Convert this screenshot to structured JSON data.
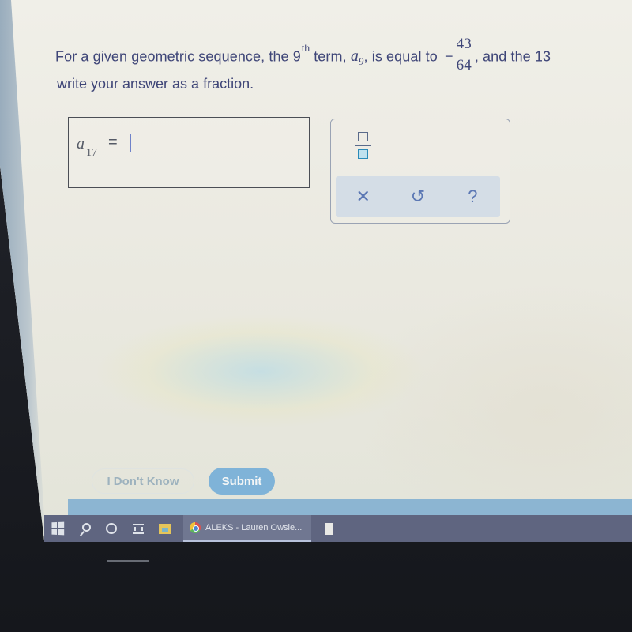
{
  "question": {
    "part1": "For a given geometric sequence, the 9",
    "ordinal_suffix": "th",
    "part2": " term, ",
    "term_symbol": "a",
    "term_index": "9",
    "part3": ", is equal to",
    "value_sign": "−",
    "value_numerator": "43",
    "value_denominator": "64",
    "part4": ", and the 13",
    "line2": "write your answer as a fraction."
  },
  "answer": {
    "label_symbol": "a",
    "label_index": "17",
    "equals": "=",
    "value": ""
  },
  "palette": {
    "fraction_tool_label": "fraction",
    "actions": [
      {
        "name": "clear",
        "glyph": "✕"
      },
      {
        "name": "undo",
        "glyph": "↺"
      },
      {
        "name": "help",
        "glyph": "?"
      }
    ]
  },
  "buttons": {
    "dont_know": "I Don't Know",
    "submit": "Submit"
  },
  "colors": {
    "question_text": "#3f4678",
    "submit_bg": "#7fb3d8",
    "footer_band": "#8cb5d2",
    "taskbar": "#5f6580"
  },
  "taskbar": {
    "active_window": "ALEKS - Lauren Owsle..."
  }
}
